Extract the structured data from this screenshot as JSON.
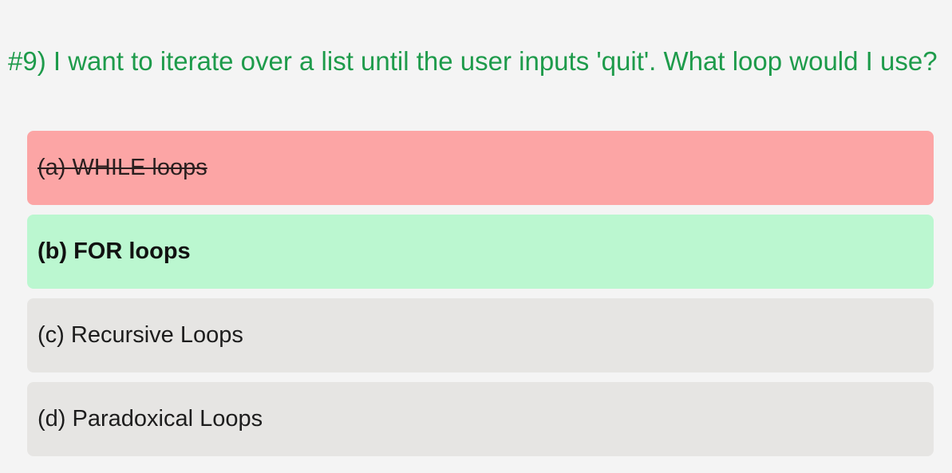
{
  "question": {
    "text": "#9) I want to iterate over a list until the user inputs 'quit'. What loop would I use?"
  },
  "options": [
    {
      "label": "(a) WHILE loops",
      "state": "wrong"
    },
    {
      "label": "(b) FOR loops",
      "state": "correct"
    },
    {
      "label": "(c) Recursive Loops",
      "state": "neutral"
    },
    {
      "label": "(d) Paradoxical Loops",
      "state": "neutral"
    }
  ],
  "colors": {
    "background": "#f4f4f4",
    "question_text": "#1e9b4b",
    "wrong_bg": "#fca5a5",
    "correct_bg": "#bbf7d0",
    "neutral_bg": "#e6e5e3"
  }
}
